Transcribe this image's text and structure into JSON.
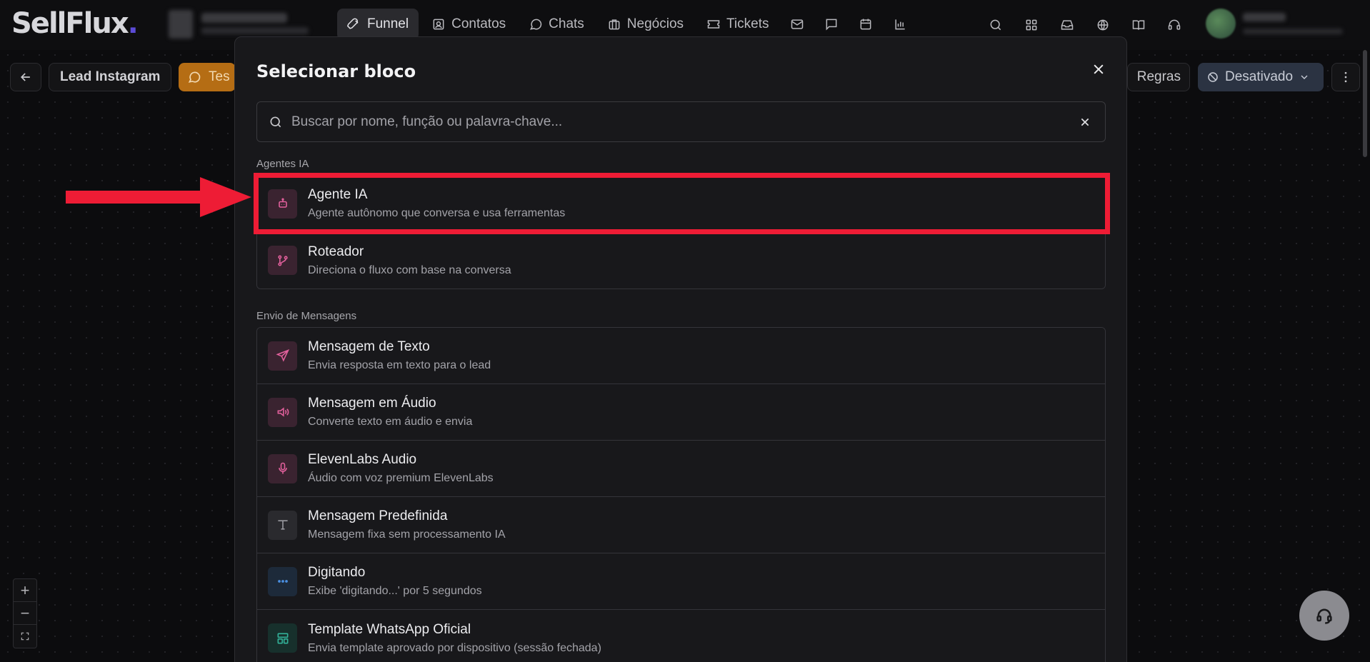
{
  "topnav": {
    "logo_main": "SellFlux",
    "logo_dot": ".",
    "tabs": [
      {
        "label": "Funnel",
        "icon": "rocket-icon"
      },
      {
        "label": "Contatos",
        "icon": "contacts-icon"
      },
      {
        "label": "Chats",
        "icon": "chat-icon"
      },
      {
        "label": "Negócios",
        "icon": "briefcase-icon"
      },
      {
        "label": "Tickets",
        "icon": "ticket-icon"
      }
    ]
  },
  "toolbar": {
    "funnel_name": "Lead Instagram",
    "test_label": "Tes",
    "rules_label": "Regras",
    "status_label": "Desativado"
  },
  "modal": {
    "title": "Selecionar bloco",
    "search_placeholder": "Buscar por nome, função ou palavra-chave...",
    "sections": [
      {
        "label": "Agentes IA",
        "items": [
          {
            "name": "Agente IA",
            "desc": "Agente autônomo que conversa e usa ferramentas",
            "icon": "bot-icon"
          },
          {
            "name": "Roteador",
            "desc": "Direciona o fluxo com base na conversa",
            "icon": "branch-icon"
          }
        ]
      },
      {
        "label": "Envio de Mensagens",
        "items": [
          {
            "name": "Mensagem de Texto",
            "desc": "Envia resposta em texto para o lead",
            "icon": "send-icon"
          },
          {
            "name": "Mensagem em Áudio",
            "desc": "Converte texto em áudio e envia",
            "icon": "speaker-icon"
          },
          {
            "name": "ElevenLabs Audio",
            "desc": "Áudio com voz premium ElevenLabs",
            "icon": "microphone-icon"
          },
          {
            "name": "Mensagem Predefinida",
            "desc": "Mensagem fixa sem processamento IA",
            "icon": "text-type-icon"
          },
          {
            "name": "Digitando",
            "desc": "Exibe 'digitando...' por 5 segundos",
            "icon": "ellipsis-icon"
          },
          {
            "name": "Template WhatsApp Oficial",
            "desc": "Envia template aprovado por dispositivo (sessão fechada)",
            "icon": "template-icon"
          }
        ]
      }
    ]
  },
  "colors": {
    "accent_pink": "#e2609c",
    "annotation_red": "#ee1c35",
    "test_orange": "#b56d14"
  }
}
